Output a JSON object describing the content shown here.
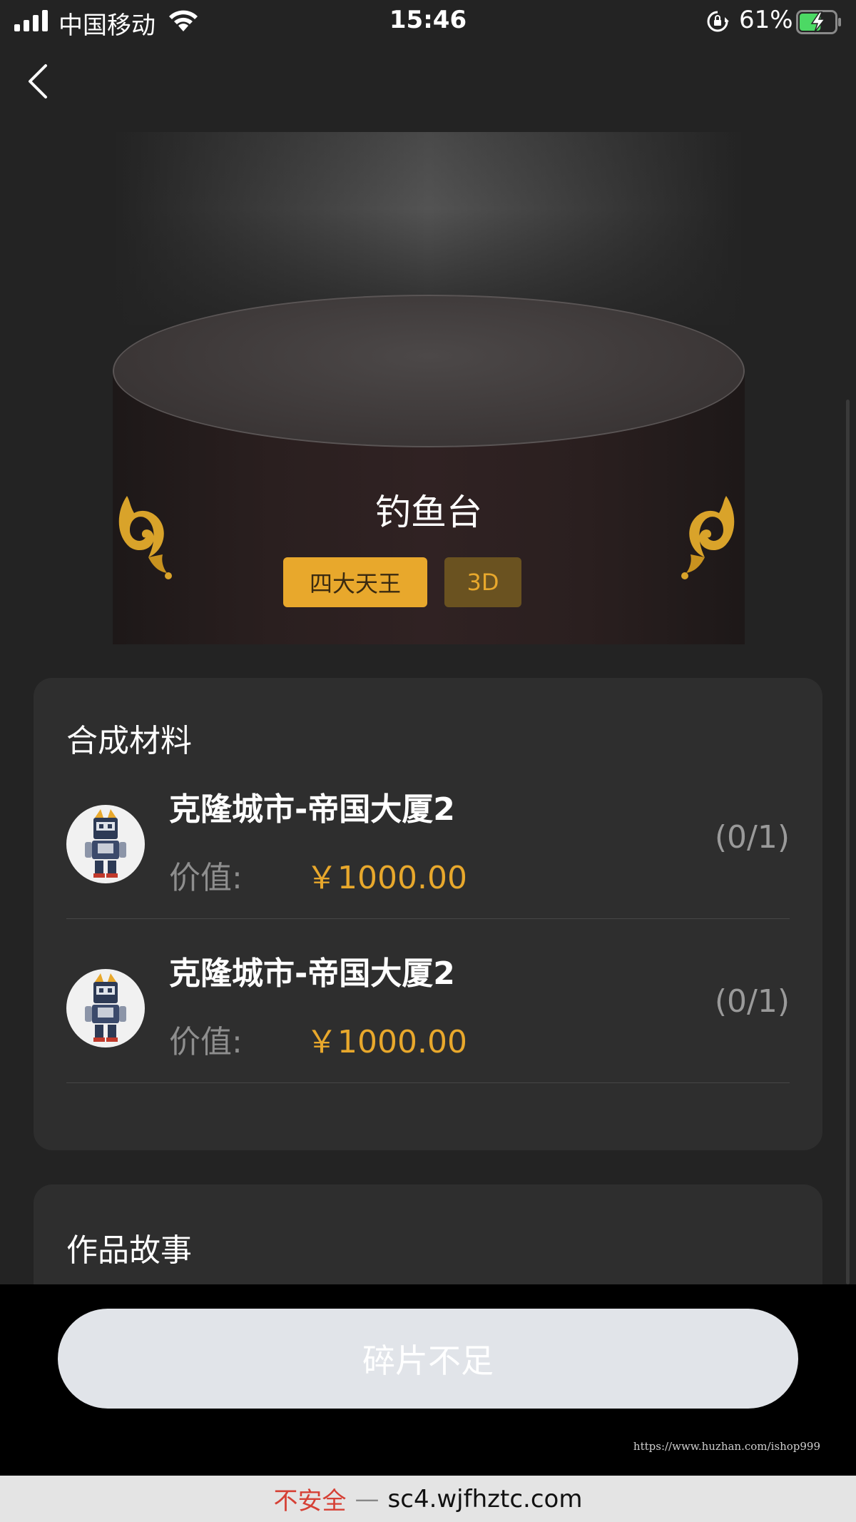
{
  "status_bar": {
    "carrier": "中国移动",
    "time": "15:46",
    "battery_percent": "61%",
    "battery_level": 0.61,
    "icons": [
      "signal-icon",
      "wifi-icon",
      "rotation-lock-icon",
      "battery-charging-icon"
    ]
  },
  "nav": {
    "back_icon": "chevron-left-icon"
  },
  "hero": {
    "title": "钓鱼台",
    "tags": [
      {
        "label": "四大天王",
        "color": "#e8a82c"
      },
      {
        "label": "3D",
        "color": "#6a5220"
      }
    ]
  },
  "materials": {
    "heading": "合成材料",
    "items": [
      {
        "name": "克隆城市-帝国大厦2",
        "value_label": "价值:",
        "value": "￥1000.00",
        "count": "(0/1)"
      },
      {
        "name": "克隆城市-帝国大厦2",
        "value_label": "价值:",
        "value": "￥1000.00",
        "count": "(0/1)"
      }
    ]
  },
  "story": {
    "heading": "作品故事"
  },
  "cta": {
    "label": "碎片不足"
  },
  "watermark": "https://www.huzhan.com/ishop999",
  "url_bar": {
    "security": "不安全",
    "separator": "—",
    "domain": "sc4.wjfhztc.com"
  },
  "colors": {
    "accent": "#e8a82c",
    "background": "#232323",
    "card": "#2e2e2e",
    "button": "#e1e4e9"
  }
}
